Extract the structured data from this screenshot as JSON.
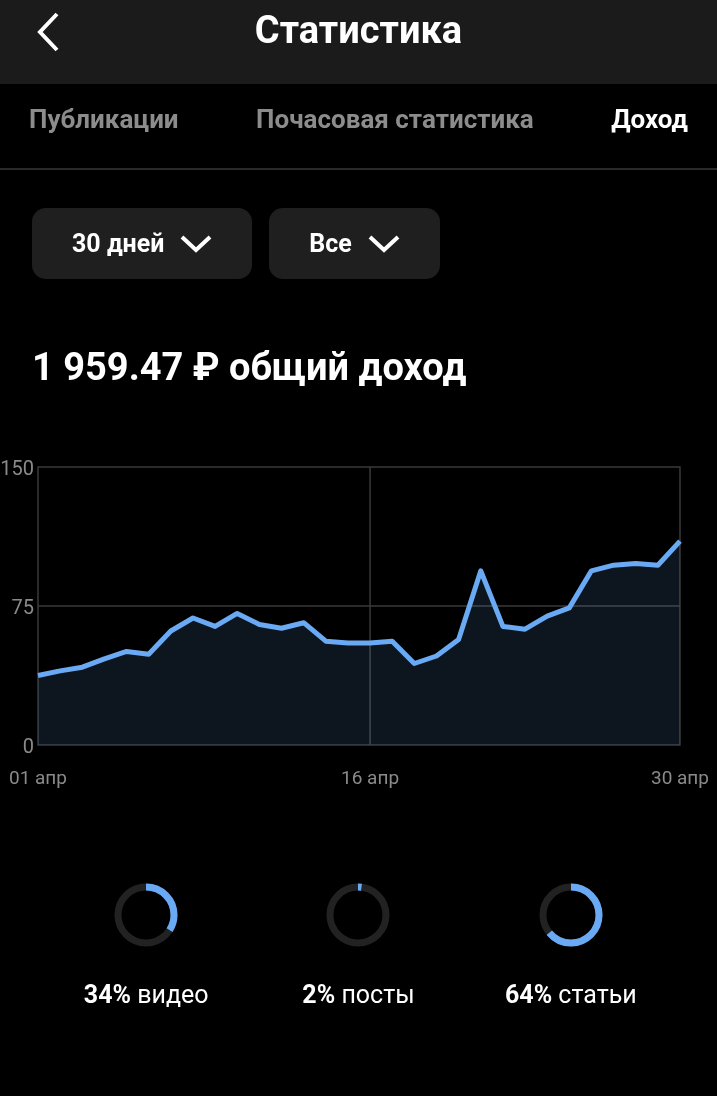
{
  "header": {
    "title": "Статистика"
  },
  "tabs": [
    {
      "label": "Публикации",
      "selected": false
    },
    {
      "label": "Почасовая статистика",
      "selected": false
    },
    {
      "label": "Доход",
      "selected": true
    }
  ],
  "filters": [
    {
      "label": "30 дней"
    },
    {
      "label": "Все"
    }
  ],
  "total": {
    "amount": "1 959.47 ₽",
    "label": "общий доход"
  },
  "chart": {
    "chart_data": {
      "type": "area",
      "x": [
        1,
        2,
        3,
        4,
        5,
        6,
        7,
        8,
        9,
        10,
        11,
        12,
        13,
        14,
        15,
        16,
        17,
        18,
        19,
        20,
        21,
        22,
        23,
        24,
        25,
        26,
        27,
        28,
        29,
        30
      ],
      "series": [
        {
          "color": "#6aaaf5",
          "values": [
            37.5,
            40,
            42,
            46.5,
            50.5,
            49,
            61.5,
            68.5,
            64,
            71,
            65,
            63,
            66,
            56,
            55,
            55,
            56,
            44,
            48,
            57,
            94,
            64,
            62.5,
            69.5,
            74,
            94,
            97,
            98,
            97,
            110
          ]
        }
      ],
      "xlim": [
        1,
        30
      ],
      "ylim": [
        0,
        150
      ],
      "xticks": [
        {
          "value": 1,
          "label": "01 апр"
        },
        {
          "value": 16,
          "label": "16 апр"
        },
        {
          "value": 30,
          "label": "30 апр"
        }
      ],
      "yticks": [
        0,
        75,
        150
      ]
    }
  },
  "breakdown": [
    {
      "percent": "34%",
      "label": "видео",
      "level": 0.34
    },
    {
      "percent": "2%",
      "label": "посты",
      "level": 0.02
    },
    {
      "percent": "64%",
      "label": "статьи",
      "level": 0.64
    }
  ]
}
